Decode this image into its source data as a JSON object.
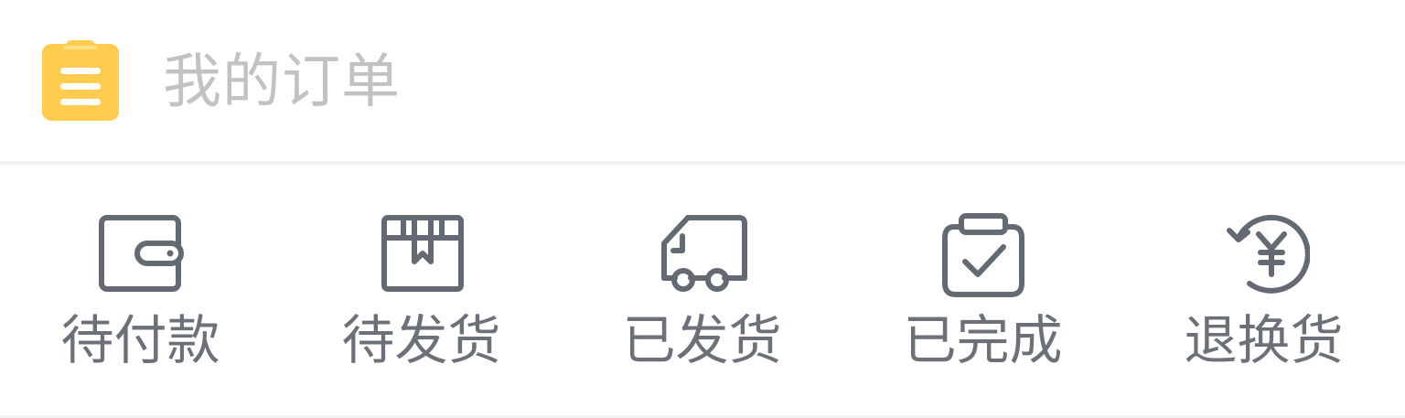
{
  "header": {
    "icon": "clipboard-list-icon",
    "icon_color": "#ffcc4f",
    "title": "我的订单"
  },
  "orders": [
    {
      "key": "pending-payment",
      "label": "待付款",
      "icon": "wallet-icon"
    },
    {
      "key": "pending-shipment",
      "label": "待发货",
      "icon": "package-icon"
    },
    {
      "key": "shipped",
      "label": "已发货",
      "icon": "truck-icon"
    },
    {
      "key": "completed",
      "label": "已完成",
      "icon": "check-clipboard-icon"
    },
    {
      "key": "refund-exchange",
      "label": "退换货",
      "icon": "refund-yen-icon"
    }
  ],
  "colors": {
    "title_text": "#c2c2c2",
    "label_text": "#6b7079",
    "icon_stroke": "#646a73",
    "divider": "#f1f1f3"
  }
}
